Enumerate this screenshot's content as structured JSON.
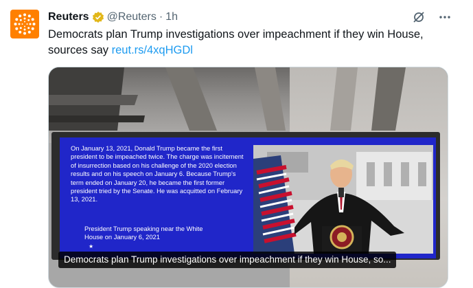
{
  "account": {
    "name": "Reuters",
    "handle": "@Reuters",
    "separator": "·",
    "time": "1h"
  },
  "tweet": {
    "text": "Democrats plan Trump investigations over impeachment if they win House, sources say",
    "link": "reut.rs/4xqHGDl"
  },
  "media": {
    "screen_text": "On January 13, 2021, Donald Trump became the first president to be impeached twice. The charge was incitement of insurrection based on his challenge of the 2020 election results and on his speech on January 6. Because Trump's term ended on January 20, he became the first former president tried by the Senate. He was acquitted on February 13, 2021.",
    "screen_caption": "President Trump speaking near the White House on January 6, 2021",
    "subtitle": "Democrats plan Trump investigations over impeachment if they win House, so..."
  },
  "icons": {
    "verified": "verified-badge-icon",
    "grok": "grok-icon",
    "more": "more-icon"
  },
  "colors": {
    "brand_orange": "#ff8000",
    "link_blue": "#1d9bf0",
    "verified_gold": "#e2b719",
    "screen_blue": "#2026c9"
  }
}
